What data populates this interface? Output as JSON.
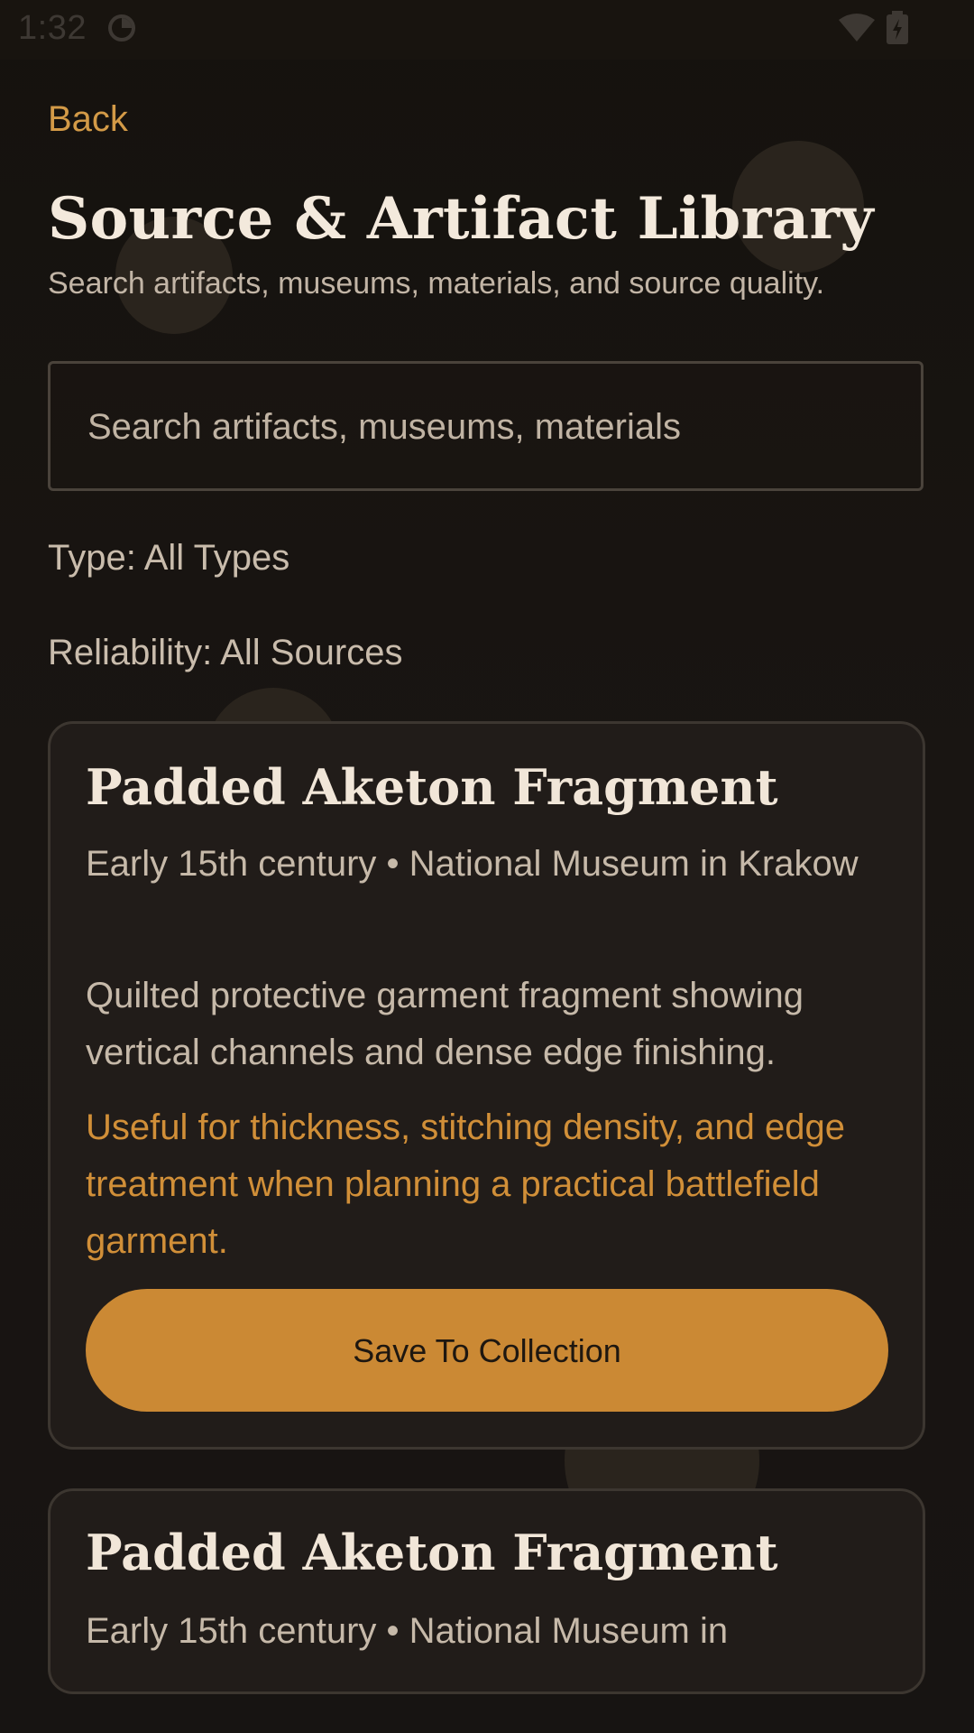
{
  "status_bar": {
    "time": "1:32",
    "icons": [
      "sync-icon",
      "wifi-icon",
      "battery-icon"
    ]
  },
  "header": {
    "back_label": "Back",
    "title": "Source & Artifact Library",
    "subtitle": "Search artifacts, museums, materials, and source quality."
  },
  "search": {
    "placeholder": "Search artifacts, museums, materials",
    "value": ""
  },
  "filters": {
    "type": "Type: All Types",
    "reliability": "Reliability: All Sources"
  },
  "results": [
    {
      "title": "Padded Aketon Fragment",
      "meta": "Early 15th century • National Museum in Krakow",
      "description": "Quilted protective garment fragment showing vertical channels and dense edge finishing.",
      "note": "Useful for thickness, stitching density, and edge treatment when planning a practical battlefield garment.",
      "action_label": "Save To Collection"
    },
    {
      "title": "Padded Aketon Fragment",
      "meta": "Early 15th century • National Museum in"
    }
  ],
  "colors": {
    "background": "#161310",
    "card": "#211c19",
    "accent": "#cb8934",
    "accent_text": "#d18f38",
    "title_text": "#f1e6d8",
    "body_text": "#c6b9a9"
  }
}
